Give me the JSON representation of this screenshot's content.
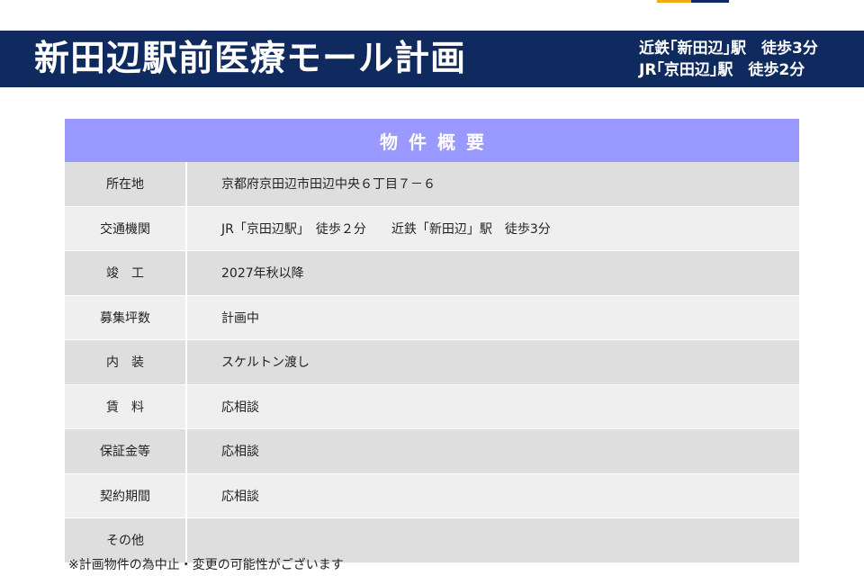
{
  "header": {
    "title": "新田辺駅前医療モール計画",
    "access_line1": "近鉄｢新田辺｣駅　徒歩3分",
    "access_line2": "JR｢京田辺｣駅　徒歩2分"
  },
  "table": {
    "heading": "物件概要",
    "rows": [
      {
        "label": "所在地",
        "value": "京都府京田辺市田辺中央６丁目７－６"
      },
      {
        "label": "交通機関",
        "value": "JR「京田辺駅」　徒歩２分　　近鉄「新田辺」駅　徒歩3分"
      },
      {
        "label": "竣　工",
        "value": "2027年秋以降"
      },
      {
        "label": "募集坪数",
        "value": "計画中"
      },
      {
        "label": "内　装",
        "value": "スケルトン渡し"
      },
      {
        "label": "賃　料",
        "value": "応相談"
      },
      {
        "label": "保証金等",
        "value": "応相談"
      },
      {
        "label": "契約期間",
        "value": "応相談"
      },
      {
        "label": "その他",
        "value": ""
      }
    ]
  },
  "footnote": "※計画物件の為中止・変更の可能性がございます",
  "colors": {
    "header_bg": "#0f2a5e",
    "table_heading_bg": "#9999ff",
    "row_dark": "#dedede",
    "row_light": "#efefef",
    "accent_orange": "#f3a81a"
  }
}
